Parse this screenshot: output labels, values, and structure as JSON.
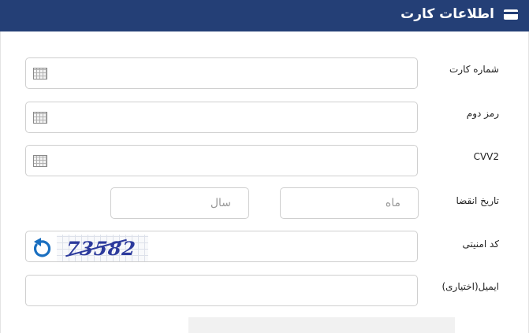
{
  "header": {
    "title": "اطلاعات کارت",
    "icon": "credit-card-icon"
  },
  "form": {
    "card_number_label": "شماره کارت",
    "second_password_label": "رمز دوم",
    "cvv2_label": "CVV2",
    "expiry_label": "تاریخ انقضا",
    "expiry_month_placeholder": "ماه",
    "expiry_year_placeholder": "سال",
    "security_code_label": "کد امنیتی",
    "captcha_text": "73582",
    "email_label": "ایمیل(اختیاری)"
  },
  "colors": {
    "header_bg": "#243f76",
    "captcha_text": "#2c3a9c",
    "refresh_icon": "#1a6fc0"
  }
}
